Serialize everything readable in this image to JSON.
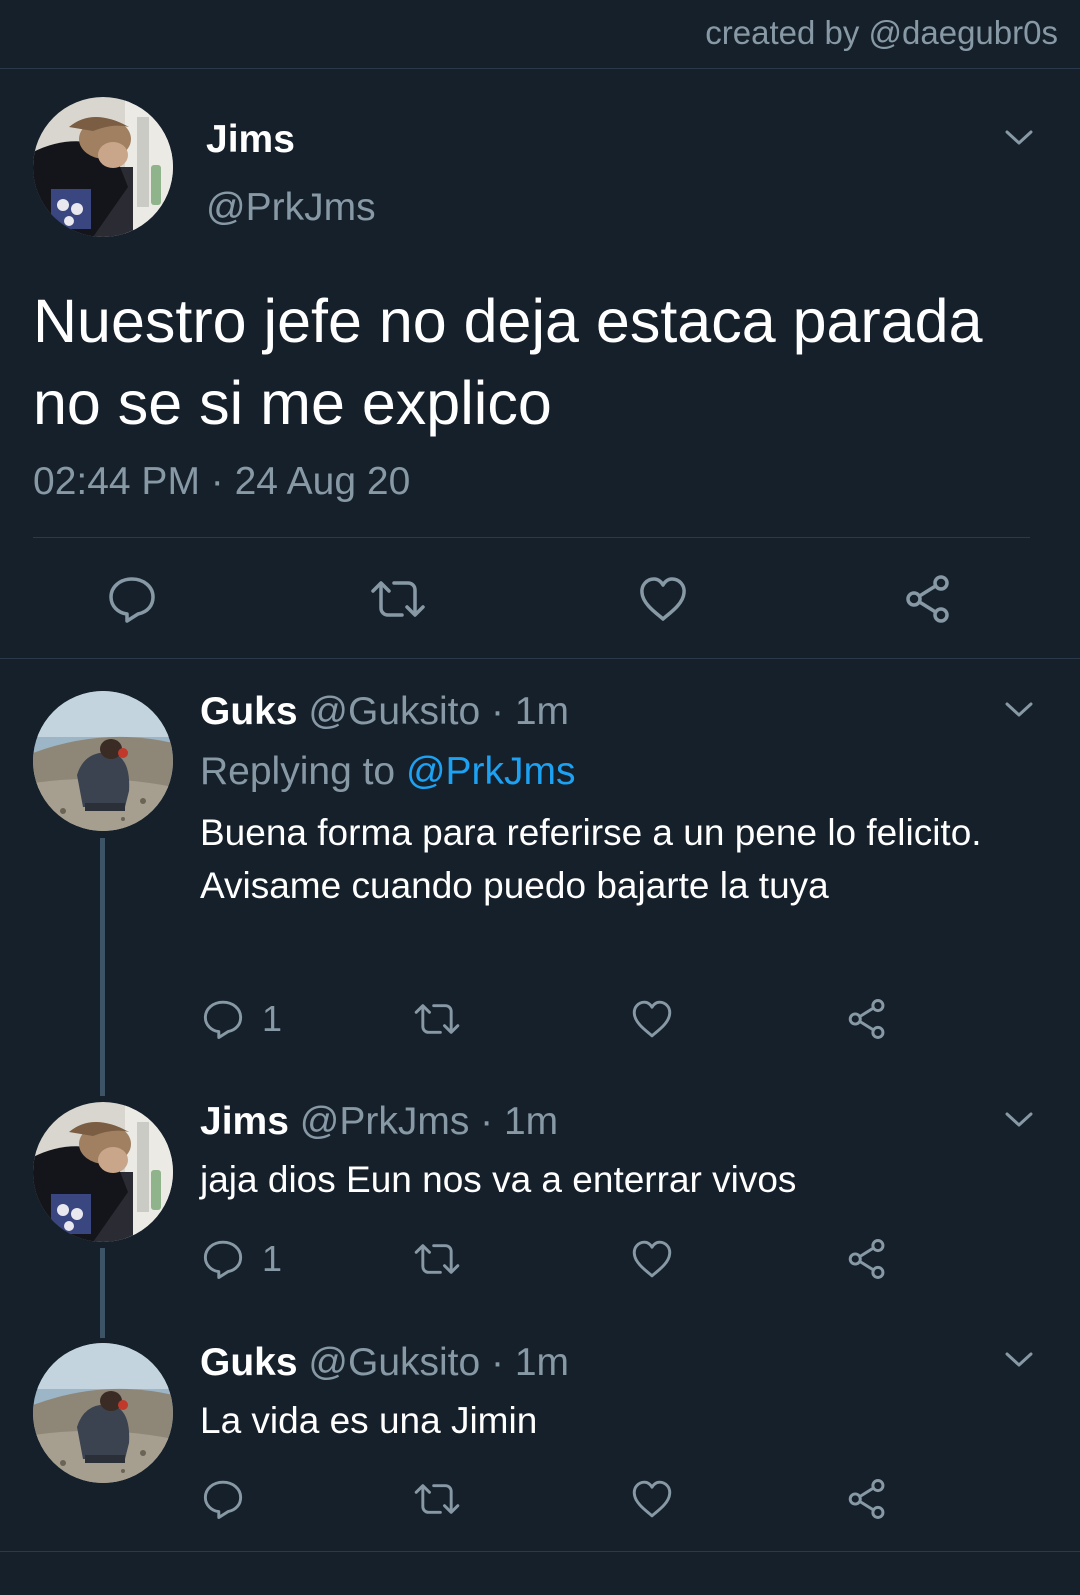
{
  "credit": "created by @daegubr0s",
  "main_tweet": {
    "name": "Jims",
    "handle": "@PrkJms",
    "text": "Nuestro jefe no deja estaca parada no se si me explico",
    "timestamp": "02:44 PM · 24 Aug 20"
  },
  "replies": [
    {
      "name": "Guks",
      "meta": "@Guksito · 1m",
      "replying_label": "Replying to ",
      "replying_to": "@PrkJms",
      "text": "Buena forma para referirse a un pene lo felicito. Avisame cuando puedo bajarte la tuya",
      "reply_count": "1"
    },
    {
      "name": "Jims",
      "meta": "@PrkJms · 1m",
      "text": "jaja dios Eun nos va a enterrar vivos",
      "reply_count": "1"
    },
    {
      "name": "Guks",
      "meta": "@Guksito · 1m",
      "text": "La vida es una Jimin",
      "reply_count": ""
    }
  ],
  "icons": [
    "chevron-down-icon",
    "reply-icon",
    "retweet-icon",
    "like-icon",
    "share-icon"
  ],
  "colors": {
    "background": "#15202b",
    "secondary_text": "#8899a6",
    "link": "#1da1f2",
    "divider": "#2b3a4a",
    "thread_line": "#3d5466"
  }
}
